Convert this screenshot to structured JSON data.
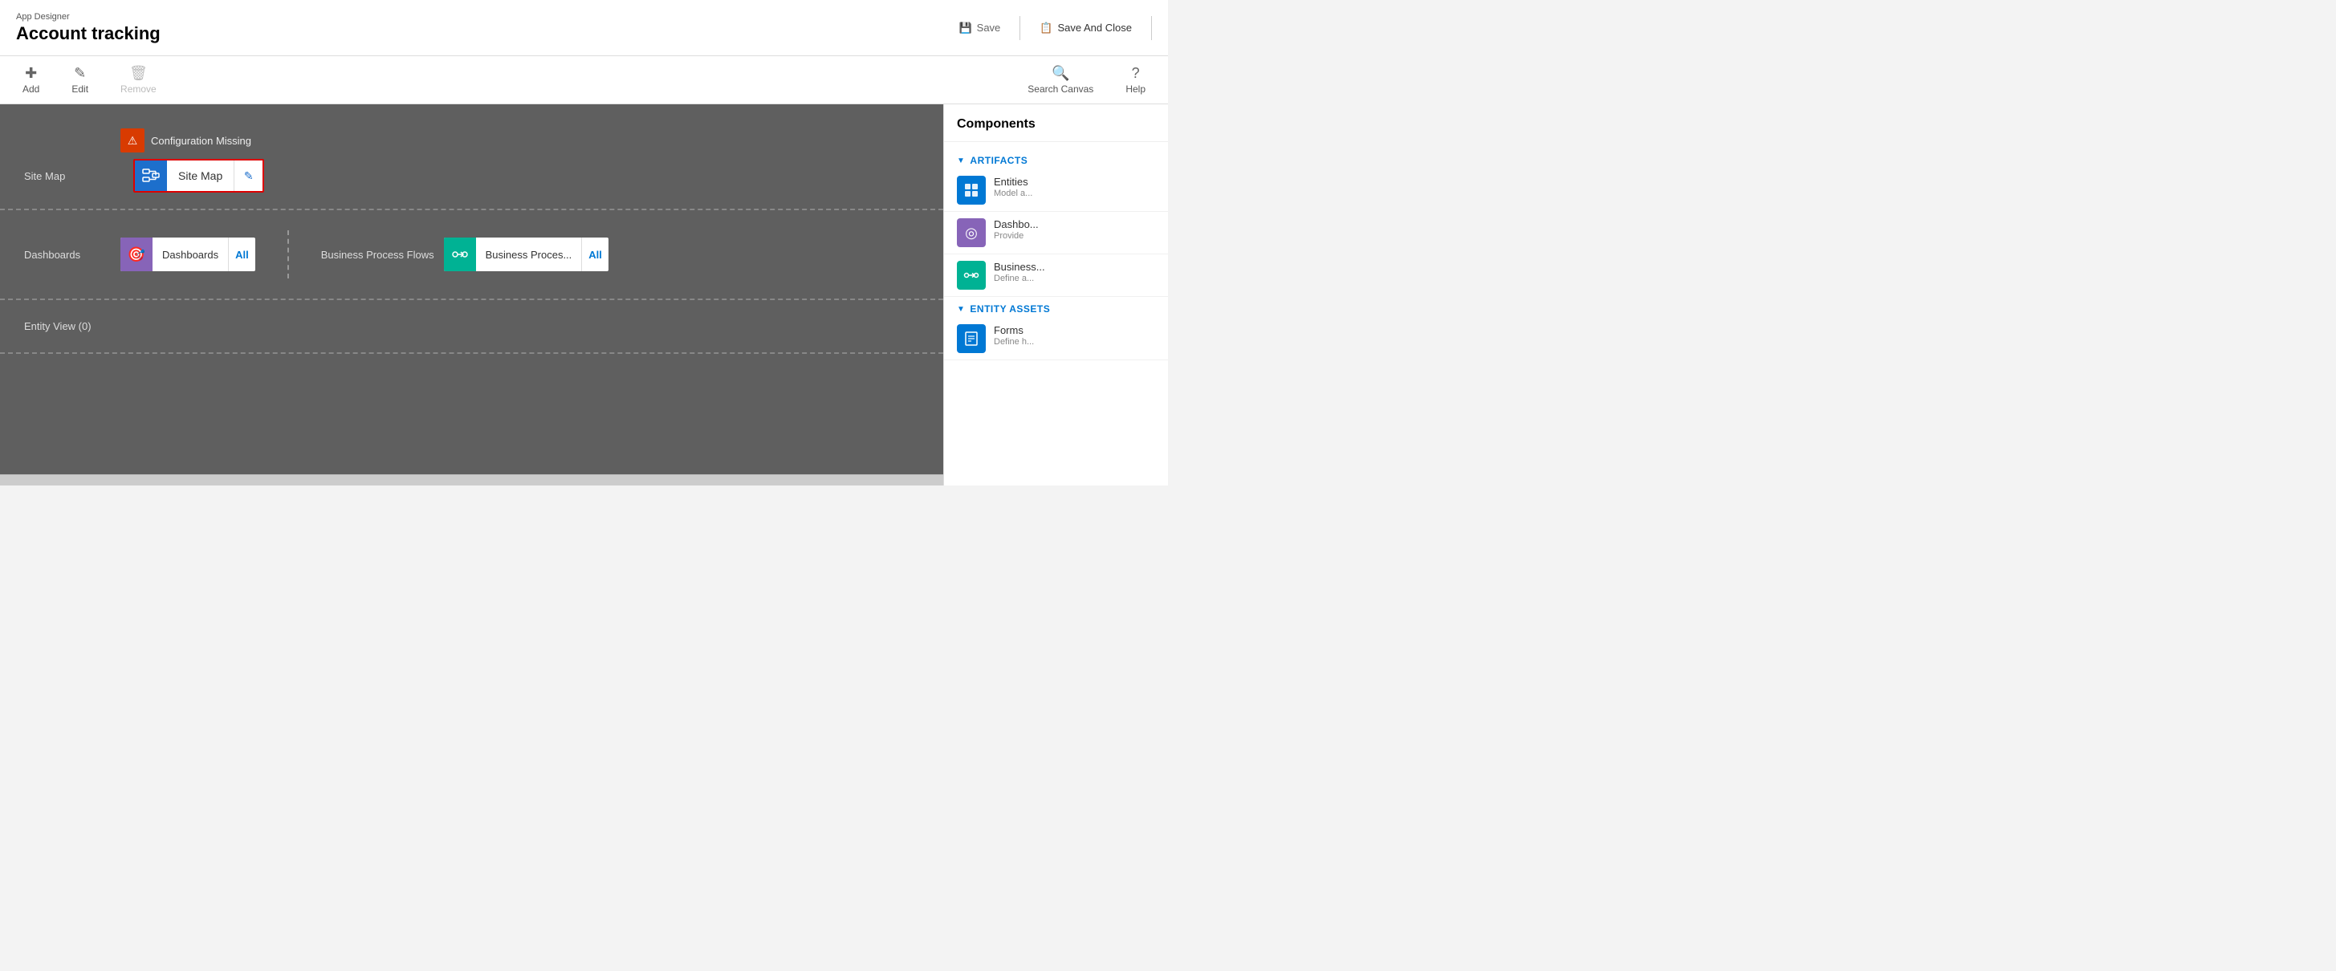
{
  "header": {
    "subtitle": "App Designer",
    "title": "Account tracking",
    "save_label": "Save",
    "save_close_label": "Save And Close"
  },
  "toolbar": {
    "add_label": "Add",
    "edit_label": "Edit",
    "remove_label": "Remove",
    "search_canvas_label": "Search Canvas",
    "help_label": "Help"
  },
  "canvas": {
    "site_map_label": "Site Map",
    "config_missing_label": "Configuration Missing",
    "site_map_card_label": "Site Map",
    "dashboards_label": "Dashboards",
    "dashboards_card_label": "Dashboards",
    "dashboards_all": "All",
    "bpf_label": "Business Process Flows",
    "bpf_card_label": "Business Proces...",
    "bpf_all": "All",
    "entity_view_label": "Entity View (0)"
  },
  "components": {
    "panel_title": "Components",
    "artifacts_label": "ARTIFACTS",
    "entity_assets_label": "ENTITY ASSETS",
    "items": [
      {
        "name": "Entities",
        "desc": "Model a...",
        "icon_type": "blue",
        "icon": "⊞"
      },
      {
        "name": "Dashbo...",
        "desc": "Provide",
        "icon_type": "purple",
        "icon": "◎"
      },
      {
        "name": "Business...",
        "desc": "Define a...",
        "icon_type": "green",
        "icon": "⊶"
      },
      {
        "name": "Forms",
        "desc": "Define h...",
        "icon_type": "blue",
        "icon": "☰"
      }
    ]
  }
}
